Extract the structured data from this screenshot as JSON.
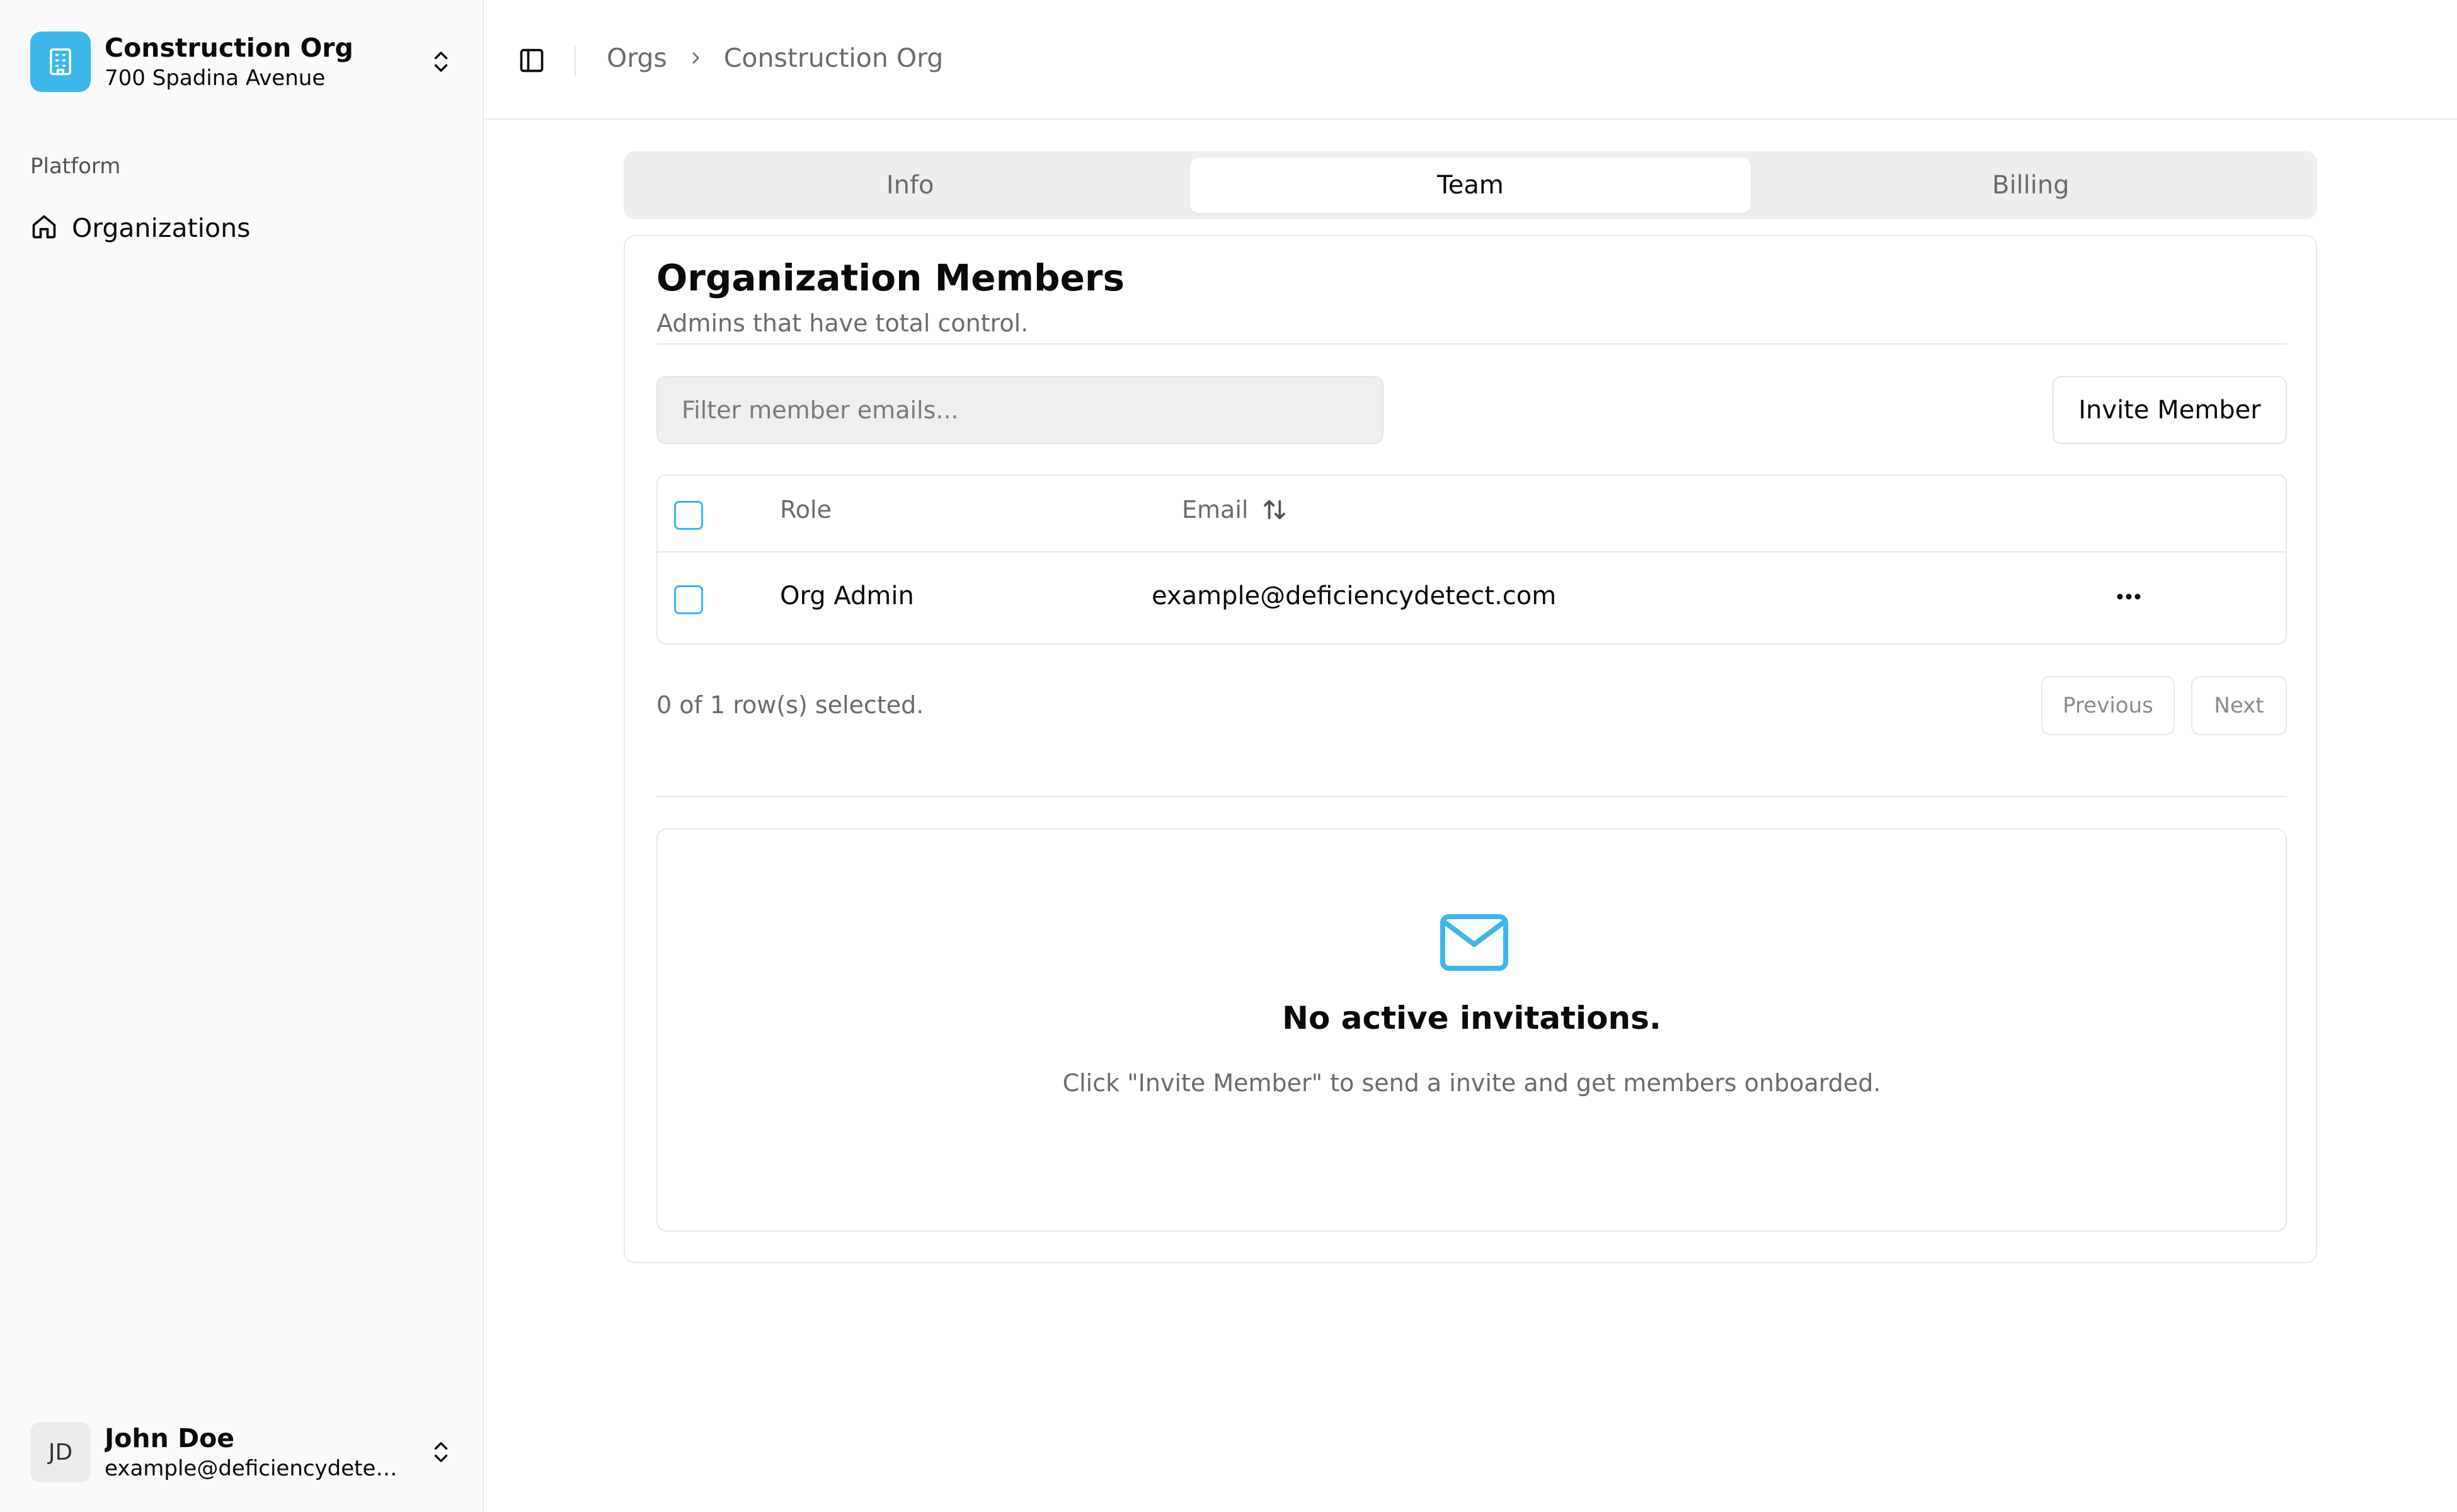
{
  "colors": {
    "accent": "#3db7ea",
    "sidebar_bg": "#fafafa",
    "muted_text": "#6b6b6b",
    "border": "#e6e6e6"
  },
  "sidebar": {
    "org": {
      "name": "Construction Org",
      "address": "700 Spadina Avenue",
      "logo_icon": "building-icon",
      "switcher_icon": "chevrons-up-down-icon"
    },
    "section_label": "Platform",
    "items": [
      {
        "label": "Organizations",
        "icon": "home-icon"
      }
    ],
    "user": {
      "initials": "JD",
      "name": "John Doe",
      "email": "example@deficiencydetect....",
      "switcher_icon": "chevrons-up-down-icon"
    }
  },
  "header": {
    "toggle_icon": "panel-left-icon",
    "breadcrumb": [
      "Orgs",
      "Construction Org"
    ],
    "separator_icon": "chevron-right-icon"
  },
  "tabs": [
    {
      "label": "Info",
      "active": false
    },
    {
      "label": "Team",
      "active": true
    },
    {
      "label": "Billing",
      "active": false
    }
  ],
  "members": {
    "title": "Organization Members",
    "description": "Admins that have total control.",
    "filter_placeholder": "Filter member emails...",
    "filter_value": "",
    "invite_label": "Invite Member",
    "columns": {
      "role": "Role",
      "email": "Email",
      "sort_icon": "arrow-up-down-icon"
    },
    "rows": [
      {
        "role": "Org Admin",
        "email": "example@deficiencydetect.com",
        "selected": false,
        "menu_icon": "more-horizontal-icon"
      }
    ],
    "selection_status": "0 of 1 row(s) selected.",
    "pagination": {
      "previous": "Previous",
      "next": "Next"
    }
  },
  "invitations": {
    "icon": "mail-icon",
    "empty_title": "No active invitations.",
    "empty_description": "Click \"Invite Member\" to send a invite and get members onboarded."
  }
}
